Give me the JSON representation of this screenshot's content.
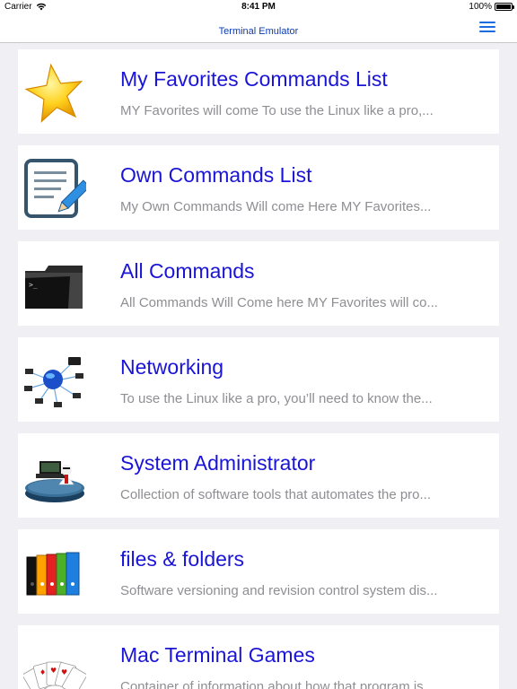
{
  "status_bar": {
    "carrier": "Carrier",
    "time": "8:41 PM",
    "battery": "100%"
  },
  "nav": {
    "title": "Terminal Emulator",
    "menu_icon": "hamburger-menu-icon"
  },
  "colors": {
    "title_text": "#1a14d6",
    "nav_title": "#0b3bb5",
    "menu_icon": "#1a6be0",
    "description_text": "#8e8e93",
    "background": "#efeff4"
  },
  "items": [
    {
      "title": "My Favorites Commands List",
      "description": "MY Favorites will come To use the Linux  like a pro,...",
      "icon": "star-icon"
    },
    {
      "title": "Own Commands List",
      "description": "My Own Commands Will come Here MY Favorites...",
      "icon": "notepad-pencil-icon"
    },
    {
      "title": "All Commands",
      "description": "All Commands Will Come here MY Favorites will co...",
      "icon": "terminal-folder-icon"
    },
    {
      "title": "Networking",
      "description": "To use the Linux  like a pro, you’ll need to know the...",
      "icon": "network-globe-icon"
    },
    {
      "title": "System Administrator",
      "description": "Collection of software tools that automates the pro...",
      "icon": "sysadmin-icon"
    },
    {
      "title": "files & folders",
      "description": "Software versioning and revision control system dis...",
      "icon": "binders-icon"
    },
    {
      "title": "Mac Terminal Games",
      "description": "Container of information about how that program is...",
      "icon": "playing-cards-icon"
    }
  ]
}
